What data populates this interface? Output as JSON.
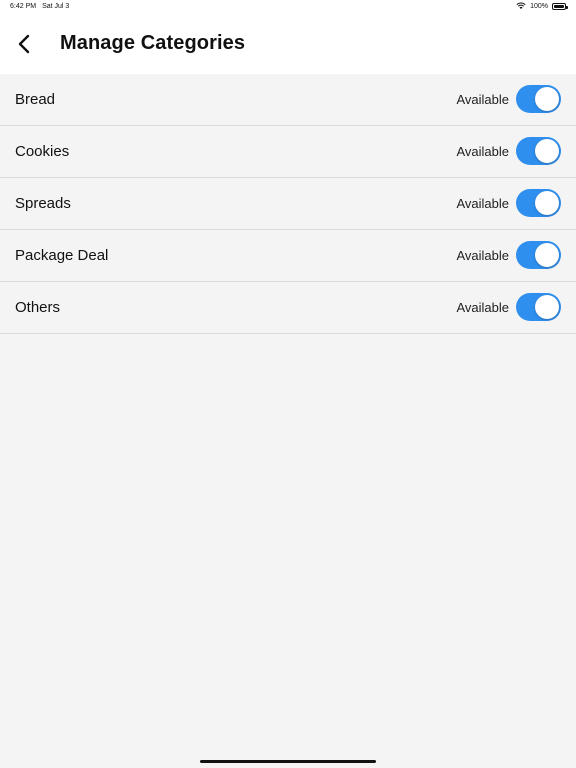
{
  "status_bar": {
    "time": "6:42 PM",
    "date": "Sat Jul 3",
    "battery": "100%",
    "battery_level": 1.0
  },
  "header": {
    "back_icon": "chevron-left-icon",
    "title": "Manage Categories"
  },
  "categories": [
    {
      "name": "Bread",
      "status": "Available",
      "enabled": true
    },
    {
      "name": "Cookies",
      "status": "Available",
      "enabled": true
    },
    {
      "name": "Spreads",
      "status": "Available",
      "enabled": true
    },
    {
      "name": "Package Deal",
      "status": "Available",
      "enabled": true
    },
    {
      "name": "Others",
      "status": "Available",
      "enabled": true
    }
  ],
  "colors": {
    "toggle_on": "#2f8fee",
    "background": "#f4f4f4",
    "header": "#ffffff"
  }
}
